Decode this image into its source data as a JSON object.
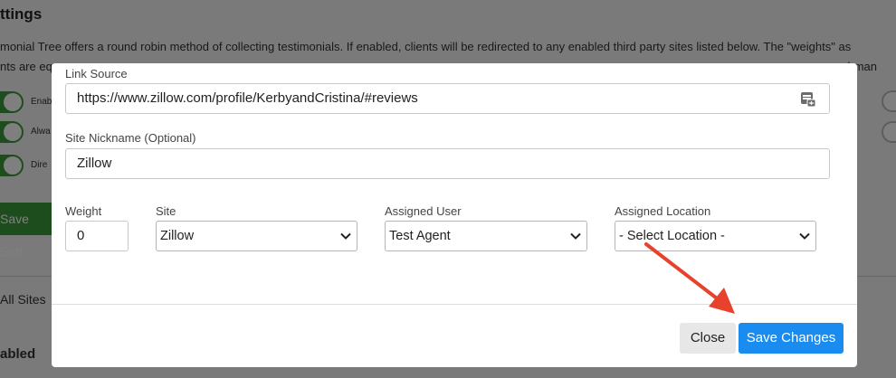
{
  "background": {
    "title": "ttings",
    "description_line1": "monial Tree offers a round robin method of collecting testimonials. If enabled, clients will be redirected to any enabled third party sites listed below. The \"weights\" as",
    "description_line2": "nts are eq",
    "description_line2_tail": "chman",
    "toggles": [
      {
        "label": "Enab"
      },
      {
        "label": "Alwa"
      },
      {
        "label": "Dire"
      }
    ],
    "save_button": "Save Sett",
    "all_sites": "All Sites",
    "enabled": "abled"
  },
  "modal": {
    "link_source": {
      "label": "Link Source",
      "value": "https://www.zillow.com/profile/KerbyandCristina/#reviews"
    },
    "site_nickname": {
      "label": "Site Nickname (Optional)",
      "value": "Zillow"
    },
    "weight": {
      "label": "Weight",
      "value": "0"
    },
    "site": {
      "label": "Site",
      "value": "Zillow"
    },
    "assigned_user": {
      "label": "Assigned User",
      "value": "Test Agent"
    },
    "assigned_location": {
      "label": "Assigned Location",
      "value": "- Select Location -"
    },
    "close_button": "Close",
    "save_button": "Save Changes"
  },
  "colors": {
    "primary": "#1a8cf0",
    "toggle_on": "#3a9b3a",
    "arrow": "#e8412c"
  },
  "icons": {
    "paste": "paste-icon",
    "select_chevron": "chevron-down-icon"
  }
}
